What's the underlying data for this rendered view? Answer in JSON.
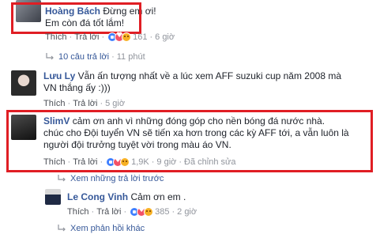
{
  "comments": [
    {
      "author": "Hoàng Bách",
      "text_inline": "Đừng em ơi!",
      "text_line2": "Em còn đá tốt lắm!",
      "like_label": "Thích",
      "reply_label": "Trả lời",
      "reactions": [
        "like",
        "love",
        "sad"
      ],
      "count": "161",
      "time": "6 giờ"
    },
    {
      "author": "Lưu Ly",
      "text_inline": "Vẫn ấn tượng nhất về a lúc xem AFF suzuki cup năm 2008 mà",
      "text_line2": "VN thắng ấy :)))",
      "like_label": "Thích",
      "reply_label": "Trả lời",
      "time": "5 giờ"
    },
    {
      "author": "SlimV",
      "text_inline": "cảm ơn anh vì những đóng góp cho nền bóng đá nước nhà.",
      "text_line2": "chúc cho Đội tuyển VN sẽ tiến xa hơn trong các kỳ AFF tới, a vẫn luôn là",
      "text_line3": "người đội trưởng tuyệt vời trong màu áo VN.",
      "like_label": "Thích",
      "reply_label": "Trả lời",
      "reactions": [
        "like",
        "love",
        "sad"
      ],
      "count": "1,9K",
      "time": "9 giờ",
      "edited": "Đã chỉnh sửa"
    },
    {
      "author": "Le Cong Vinh",
      "text_inline": "Cảm ơn em .",
      "like_label": "Thích",
      "reply_label": "Trả lời",
      "reactions": [
        "like",
        "love",
        "sad"
      ],
      "count": "385",
      "time": "2 giờ"
    }
  ],
  "more_replies_1": {
    "label": "10 câu trả lời",
    "time": "11 phút"
  },
  "view_earlier": "Xem những trả lời trước",
  "view_more": "Xem phản hồi khác",
  "colors": {
    "link": "#365899",
    "highlight": "#e01e24",
    "meta": "#90949c"
  },
  "icons": [
    "reply-arrow-icon",
    "reply-arrow-icon"
  ]
}
